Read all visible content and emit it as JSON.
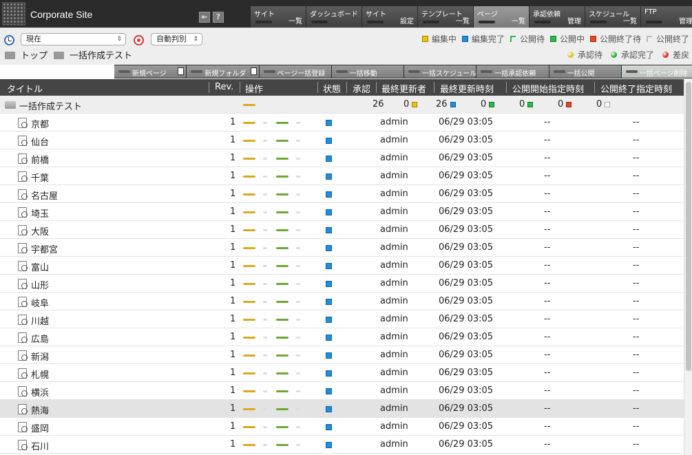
{
  "header": {
    "site_name": "Corporate Site",
    "help_icon_text": "?",
    "menu": [
      {
        "top": "サイト",
        "bottom": "一覧",
        "active": false
      },
      {
        "top": "ダッシュボード",
        "bottom": "",
        "active": false
      },
      {
        "top": "サイト",
        "bottom": "設定",
        "active": false
      },
      {
        "top": "テンプレート",
        "bottom": "一覧",
        "active": false
      },
      {
        "top": "ページ",
        "bottom": "一覧",
        "active": true
      },
      {
        "top": "承認依頼",
        "bottom": "管理",
        "active": false
      },
      {
        "top": "スケジュール",
        "bottom": "一覧",
        "active": false
      },
      {
        "top": "FTP",
        "bottom": "管理",
        "active": false
      }
    ]
  },
  "toolbar": {
    "time_select": "現在",
    "mode_select": "自動判別",
    "breadcrumb": {
      "top": "トップ",
      "current": "一括作成テスト"
    },
    "legend_row1": [
      {
        "label": "編集中",
        "icon": "edit-square",
        "color": "#f2c400"
      },
      {
        "label": "編集完了",
        "icon": "done-square",
        "color": "#1d8fe0"
      },
      {
        "label": "公開待",
        "icon": "pending-flag",
        "color": "#2db84a"
      },
      {
        "label": "公開中",
        "icon": "live-square",
        "color": "#2db84a"
      },
      {
        "label": "公開終了待",
        "icon": "end-pending-square",
        "color": "#e5471f"
      },
      {
        "label": "公開終了",
        "icon": "ended-flag",
        "color": "#bbbbbb"
      }
    ],
    "legend_row2": [
      {
        "label": "承認待",
        "color": "#e0c020"
      },
      {
        "label": "承認完了",
        "color": "#25b030"
      },
      {
        "label": "差戻",
        "color": "#d83030"
      }
    ]
  },
  "actions": [
    {
      "label": "新規ページ",
      "icon": "new-page-icon",
      "active": false
    },
    {
      "label": "新規フォルダ",
      "icon": "new-folder-icon",
      "active": false
    },
    {
      "label": "ページ一括登録",
      "icon": "",
      "active": false
    },
    {
      "label": "一括移動",
      "icon": "",
      "active": false
    },
    {
      "label": "一括スケジュール",
      "icon": "",
      "active": false
    },
    {
      "label": "一括承認依頼",
      "icon": "",
      "active": false
    },
    {
      "label": "一括公開",
      "icon": "",
      "active": false
    },
    {
      "label": "一括ページ削除",
      "icon": "",
      "active": true
    }
  ],
  "table": {
    "columns": [
      "タイトル",
      "Rev.",
      "操作",
      "状態",
      "承認",
      "最終更新者",
      "最終更新時刻",
      "公開開始指定時刻",
      "公開終了指定時刻"
    ],
    "folder_row": {
      "title": "一括作成テスト",
      "total": "26",
      "counts": [
        {
          "value": "0",
          "color": "#f2c400"
        },
        {
          "value": "26",
          "color": "#1d8fe0"
        },
        {
          "value": "0",
          "color": "#2db84a"
        },
        {
          "value": "0",
          "color": "#2db84a"
        },
        {
          "value": "0",
          "color": "#e5471f"
        },
        {
          "value": "0",
          "color": "#ffffff"
        }
      ]
    },
    "rows": [
      {
        "title": "京都",
        "rev": "1",
        "user": "admin",
        "time": "06/29 03:05",
        "start": "--",
        "end": "--"
      },
      {
        "title": "仙台",
        "rev": "1",
        "user": "admin",
        "time": "06/29 03:05",
        "start": "--",
        "end": "--"
      },
      {
        "title": "前橋",
        "rev": "1",
        "user": "admin",
        "time": "06/29 03:05",
        "start": "--",
        "end": "--"
      },
      {
        "title": "千葉",
        "rev": "1",
        "user": "admin",
        "time": "06/29 03:05",
        "start": "--",
        "end": "--"
      },
      {
        "title": "名古屋",
        "rev": "1",
        "user": "admin",
        "time": "06/29 03:05",
        "start": "--",
        "end": "--"
      },
      {
        "title": "埼玉",
        "rev": "1",
        "user": "admin",
        "time": "06/29 03:05",
        "start": "--",
        "end": "--"
      },
      {
        "title": "大阪",
        "rev": "1",
        "user": "admin",
        "time": "06/29 03:05",
        "start": "--",
        "end": "--"
      },
      {
        "title": "宇都宮",
        "rev": "1",
        "user": "admin",
        "time": "06/29 03:05",
        "start": "--",
        "end": "--"
      },
      {
        "title": "富山",
        "rev": "1",
        "user": "admin",
        "time": "06/29 03:05",
        "start": "--",
        "end": "--"
      },
      {
        "title": "山形",
        "rev": "1",
        "user": "admin",
        "time": "06/29 03:05",
        "start": "--",
        "end": "--"
      },
      {
        "title": "岐阜",
        "rev": "1",
        "user": "admin",
        "time": "06/29 03:05",
        "start": "--",
        "end": "--"
      },
      {
        "title": "川越",
        "rev": "1",
        "user": "admin",
        "time": "06/29 03:05",
        "start": "--",
        "end": "--"
      },
      {
        "title": "広島",
        "rev": "1",
        "user": "admin",
        "time": "06/29 03:05",
        "start": "--",
        "end": "--"
      },
      {
        "title": "新潟",
        "rev": "1",
        "user": "admin",
        "time": "06/29 03:05",
        "start": "--",
        "end": "--"
      },
      {
        "title": "札幌",
        "rev": "1",
        "user": "admin",
        "time": "06/29 03:05",
        "start": "--",
        "end": "--"
      },
      {
        "title": "横浜",
        "rev": "1",
        "user": "admin",
        "time": "06/29 03:05",
        "start": "--",
        "end": "--"
      },
      {
        "title": "熱海",
        "rev": "1",
        "user": "admin",
        "time": "06/29 03:05",
        "start": "--",
        "end": "--",
        "highlight": true
      },
      {
        "title": "盛岡",
        "rev": "1",
        "user": "admin",
        "time": "06/29 03:05",
        "start": "--",
        "end": "--"
      },
      {
        "title": "石川",
        "rev": "1",
        "user": "admin",
        "time": "06/29 03:05",
        "start": "--",
        "end": "--"
      }
    ]
  }
}
